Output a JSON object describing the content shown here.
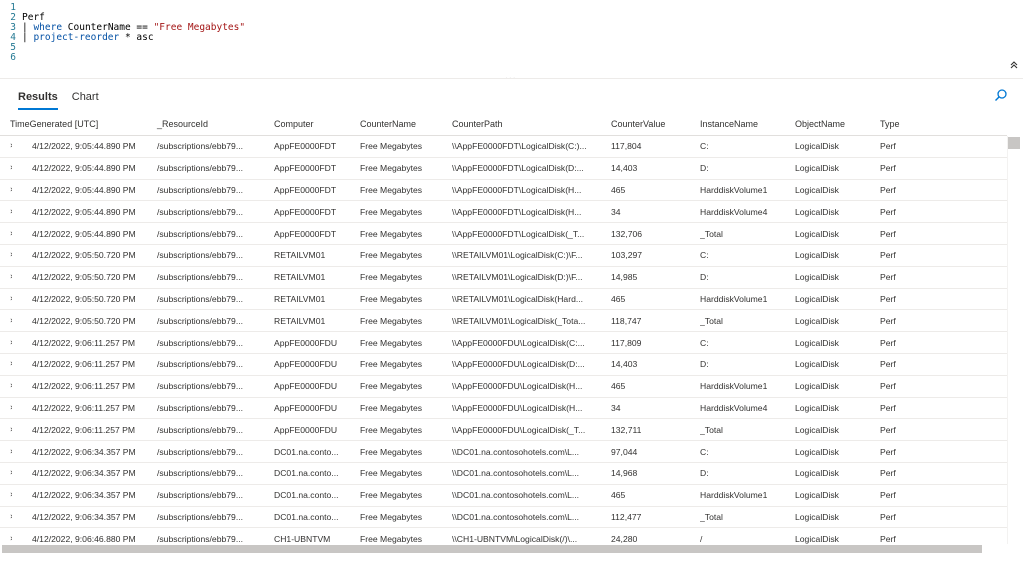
{
  "editor": {
    "lines": [
      {
        "num": "1"
      },
      {
        "num": "2",
        "text": "Perf"
      },
      {
        "num": "3",
        "pipe": "| ",
        "keyword": "where",
        "rest": " CounterName == ",
        "string": "\"Free Megabytes\""
      },
      {
        "num": "4",
        "pipe": "| ",
        "keyword": "project-reorder",
        "rest": " * asc"
      },
      {
        "num": "5"
      },
      {
        "num": "6"
      }
    ],
    "grip_glyph": "...",
    "collapse_icon": "chevron-double-up-icon",
    "collapse_glyph": "⌃"
  },
  "tabs": [
    {
      "label": "Results",
      "active": true
    },
    {
      "label": "Chart",
      "active": false
    }
  ],
  "search_icon": "search-icon",
  "accent_color": "#0078d4",
  "grid": {
    "columns": [
      "TimeGenerated [UTC]",
      "_ResourceId",
      "Computer",
      "CounterName",
      "CounterPath",
      "CounterValue",
      "InstanceName",
      "ObjectName",
      "Type"
    ],
    "expand_glyph": "›",
    "rows": [
      [
        "4/12/2022, 9:05:44.890 PM",
        "/subscriptions/ebb79...",
        "AppFE0000FDT",
        "Free Megabytes",
        "\\\\AppFE0000FDT\\LogicalDisk(C:)...",
        "117,804",
        "C:",
        "LogicalDisk",
        "Perf"
      ],
      [
        "4/12/2022, 9:05:44.890 PM",
        "/subscriptions/ebb79...",
        "AppFE0000FDT",
        "Free Megabytes",
        "\\\\AppFE0000FDT\\LogicalDisk(D:...",
        "14,403",
        "D:",
        "LogicalDisk",
        "Perf"
      ],
      [
        "4/12/2022, 9:05:44.890 PM",
        "/subscriptions/ebb79...",
        "AppFE0000FDT",
        "Free Megabytes",
        "\\\\AppFE0000FDT\\LogicalDisk(H...",
        "465",
        "HarddiskVolume1",
        "LogicalDisk",
        "Perf"
      ],
      [
        "4/12/2022, 9:05:44.890 PM",
        "/subscriptions/ebb79...",
        "AppFE0000FDT",
        "Free Megabytes",
        "\\\\AppFE0000FDT\\LogicalDisk(H...",
        "34",
        "HarddiskVolume4",
        "LogicalDisk",
        "Perf"
      ],
      [
        "4/12/2022, 9:05:44.890 PM",
        "/subscriptions/ebb79...",
        "AppFE0000FDT",
        "Free Megabytes",
        "\\\\AppFE0000FDT\\LogicalDisk(_T...",
        "132,706",
        "_Total",
        "LogicalDisk",
        "Perf"
      ],
      [
        "4/12/2022, 9:05:50.720 PM",
        "/subscriptions/ebb79...",
        "RETAILVM01",
        "Free Megabytes",
        "\\\\RETAILVM01\\LogicalDisk(C:)\\F...",
        "103,297",
        "C:",
        "LogicalDisk",
        "Perf"
      ],
      [
        "4/12/2022, 9:05:50.720 PM",
        "/subscriptions/ebb79...",
        "RETAILVM01",
        "Free Megabytes",
        "\\\\RETAILVM01\\LogicalDisk(D:)\\F...",
        "14,985",
        "D:",
        "LogicalDisk",
        "Perf"
      ],
      [
        "4/12/2022, 9:05:50.720 PM",
        "/subscriptions/ebb79...",
        "RETAILVM01",
        "Free Megabytes",
        "\\\\RETAILVM01\\LogicalDisk(Hard...",
        "465",
        "HarddiskVolume1",
        "LogicalDisk",
        "Perf"
      ],
      [
        "4/12/2022, 9:05:50.720 PM",
        "/subscriptions/ebb79...",
        "RETAILVM01",
        "Free Megabytes",
        "\\\\RETAILVM01\\LogicalDisk(_Tota...",
        "118,747",
        "_Total",
        "LogicalDisk",
        "Perf"
      ],
      [
        "4/12/2022, 9:06:11.257 PM",
        "/subscriptions/ebb79...",
        "AppFE0000FDU",
        "Free Megabytes",
        "\\\\AppFE0000FDU\\LogicalDisk(C:...",
        "117,809",
        "C:",
        "LogicalDisk",
        "Perf"
      ],
      [
        "4/12/2022, 9:06:11.257 PM",
        "/subscriptions/ebb79...",
        "AppFE0000FDU",
        "Free Megabytes",
        "\\\\AppFE0000FDU\\LogicalDisk(D:...",
        "14,403",
        "D:",
        "LogicalDisk",
        "Perf"
      ],
      [
        "4/12/2022, 9:06:11.257 PM",
        "/subscriptions/ebb79...",
        "AppFE0000FDU",
        "Free Megabytes",
        "\\\\AppFE0000FDU\\LogicalDisk(H...",
        "465",
        "HarddiskVolume1",
        "LogicalDisk",
        "Perf"
      ],
      [
        "4/12/2022, 9:06:11.257 PM",
        "/subscriptions/ebb79...",
        "AppFE0000FDU",
        "Free Megabytes",
        "\\\\AppFE0000FDU\\LogicalDisk(H...",
        "34",
        "HarddiskVolume4",
        "LogicalDisk",
        "Perf"
      ],
      [
        "4/12/2022, 9:06:11.257 PM",
        "/subscriptions/ebb79...",
        "AppFE0000FDU",
        "Free Megabytes",
        "\\\\AppFE0000FDU\\LogicalDisk(_T...",
        "132,711",
        "_Total",
        "LogicalDisk",
        "Perf"
      ],
      [
        "4/12/2022, 9:06:34.357 PM",
        "/subscriptions/ebb79...",
        "DC01.na.conto...",
        "Free Megabytes",
        "\\\\DC01.na.contosohotels.com\\L...",
        "97,044",
        "C:",
        "LogicalDisk",
        "Perf"
      ],
      [
        "4/12/2022, 9:06:34.357 PM",
        "/subscriptions/ebb79...",
        "DC01.na.conto...",
        "Free Megabytes",
        "\\\\DC01.na.contosohotels.com\\L...",
        "14,968",
        "D:",
        "LogicalDisk",
        "Perf"
      ],
      [
        "4/12/2022, 9:06:34.357 PM",
        "/subscriptions/ebb79...",
        "DC01.na.conto...",
        "Free Megabytes",
        "\\\\DC01.na.contosohotels.com\\L...",
        "465",
        "HarddiskVolume1",
        "LogicalDisk",
        "Perf"
      ],
      [
        "4/12/2022, 9:06:34.357 PM",
        "/subscriptions/ebb79...",
        "DC01.na.conto...",
        "Free Megabytes",
        "\\\\DC01.na.contosohotels.com\\L...",
        "112,477",
        "_Total",
        "LogicalDisk",
        "Perf"
      ],
      [
        "4/12/2022, 9:06:46.880 PM",
        "/subscriptions/ebb79...",
        "CH1-UBNTVM",
        "Free Megabytes",
        "\\\\CH1-UBNTVM\\LogicalDisk(/)\\...",
        "24,280",
        "/",
        "LogicalDisk",
        "Perf"
      ]
    ]
  }
}
